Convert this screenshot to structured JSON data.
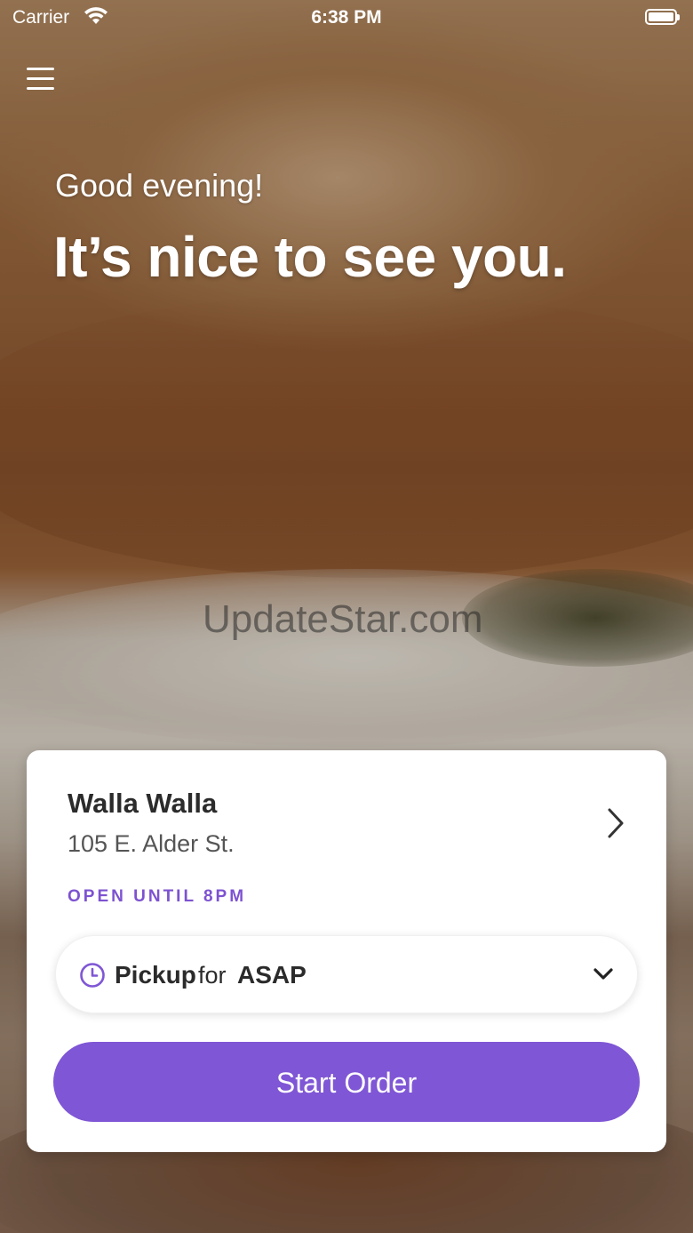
{
  "status_bar": {
    "carrier": "Carrier",
    "time": "6:38 PM"
  },
  "hero": {
    "greeting": "Good evening!",
    "headline": "It’s nice to see you."
  },
  "watermark": "UpdateStar.com",
  "store": {
    "name": "Walla Walla",
    "address": "105 E. Alder St.",
    "hours": "OPEN UNTIL 8PM"
  },
  "order_mode": {
    "mode": "Pickup",
    "connector": "for",
    "time": "ASAP"
  },
  "actions": {
    "start_order": "Start Order"
  },
  "colors": {
    "accent": "#7f56d5",
    "hours_text": "#7d52d1",
    "card_bg": "#ffffff"
  },
  "icons": [
    "wifi-icon",
    "battery-icon",
    "hamburger-menu-icon",
    "chevron-right-icon",
    "clock-icon",
    "chevron-down-icon"
  ]
}
